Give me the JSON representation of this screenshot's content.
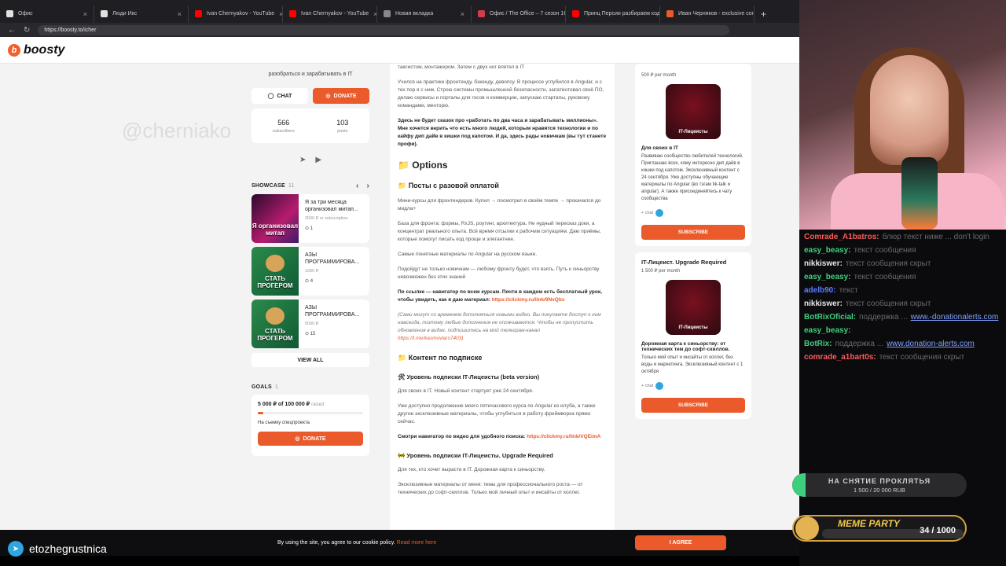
{
  "browser": {
    "tabs": [
      {
        "label": "Офис",
        "color": "#e0e0e0"
      },
      {
        "label": "Люди Икс",
        "color": "#e0e0e0"
      },
      {
        "label": "Ivan Chernyakov - YouTube",
        "color": "#ff0000"
      },
      {
        "label": "Ivan Chernyakov - YouTube",
        "color": "#ff0000"
      },
      {
        "label": "Новая вкладка",
        "color": "#888888"
      },
      {
        "label": "Офис / The Office – 7 сезон 16 се...",
        "color": "#d23b4a"
      },
      {
        "label": "Принц Персии разбираем код...",
        "color": "#ff0000"
      },
      {
        "label": "Иван Черняков - exclusive conte...",
        "color": "#ea5a2a"
      }
    ],
    "url": "https://boosty.to/icher"
  },
  "site": {
    "logo": "boosty"
  },
  "left": {
    "about": "разобраться и зарабатывать в IT",
    "chat_label": "CHAT",
    "donate_label": "DONATE",
    "subscribers_count": "566",
    "subscribers_label": "subscribers",
    "posts_count": "103",
    "posts_label": "posts",
    "showcase_title": "SHOWCASE",
    "showcase_count": "11",
    "showcase": [
      {
        "title": "Я за три месяца организовал митап...",
        "price": "3000 ₽ or subscription",
        "count": "1",
        "cap": "Я организовал митап"
      },
      {
        "title": "АЗЫ ПРОГРАММИРОВА...",
        "price": "1000 ₽",
        "count": "4",
        "cap": "СТАТЬ ПРОГЕРОМ"
      },
      {
        "title": "АЗЫ ПРОГРАММИРОВА...",
        "price": "5000 ₽",
        "count": "15",
        "cap": "СТАТЬ ПРОГЕРОМ"
      }
    ],
    "view_all": "VIEW ALL",
    "goals_title": "GOALS",
    "goals_count": "1",
    "goal_amount": "5 000 ₽ of 100 000 ₽",
    "goal_raised": "raised",
    "goal_progress": 0.05,
    "goal_name": "На съемку спецпроекта",
    "goal_donate": "DONATE"
  },
  "watermark": "@cherniako",
  "middle": {
    "p_top": "таксистом, монтажером. Затем с двух ног влетел в IT",
    "p1": "Учился на практике фронтенду, бэкенду, девопсу. В процессе углубился в Angular, и с тех пор я с ним. Строю системы промышленной безопасности, запатентовал своё ПО, делаю сервисы и порталы для госов и коммерции, запускаю стартапы, руковожу командами, менторю.",
    "p2": "Здесь не будет сказок про «работать по два часа и зарабатывать миллионы». Мне хочется верить что есть много людей, которым нравятся технологии и по кайфу дип дайв в кишки под капотом. И да, здесь рады новичкам (вы тут станете профи).",
    "options": "📁 Options",
    "posts_once": "📁 Посты с разовой оплатой",
    "p3": "Мини-курсы для фронтендеров. Купил → посмотрел в своём темпе → прокачался до мидла+",
    "p4": "База для фронта: формы, RxJS, роутинг, архитектура. Не нудный пересказ доки, а концентрат реального опыта. Всё время отсылки к рабочим ситуациям. Даю приёмы, которые помогут писать код проще и элегантнее.",
    "p5": "Самые понятные материалы по Angular на русском языке.",
    "p6": "Подойдут не только новичкам — любому фронту будет, что взять. Путь к синьорству невозможен без этих знаний",
    "p7_a": "По ссылке — навигатор по всем курсам. Почти в каждом есть бесплатный урок, чтобы увидеть, как я даю материал: ",
    "p7_link": "https://clickmy.ru/link/9NvQbs",
    "p8": "(Сами могут со временем дополняться новыми видео. Вы покупаете доступ к ним навсегда, поэтому любые дополнения не оплачиваются. Чтобы не пропустить обновления в видах, подпишитесь на мой телеграм-канал ",
    "p8_link": "https://t.me/kasmovlars7403)",
    "subs_content": "📁 Контент по подписке",
    "tier1_head": "🛠 Уровень подписки IT-Лицеисты (beta version)",
    "p9": "Для своих в IT. Новый контент стартует уже 24 сентября.",
    "p10": "Уже доступно продолжение моего пятичасового курса по Angular из ютуба, а также другие эксклюзивные материалы, чтобы углубиться в работу фреймворка прямо сейчас.",
    "p11_a": "Смотри навигатор по видео для удобного поиска: ",
    "p11_link": "https://clickmy.ru/link/VQEimA",
    "tier2_head": "🚧 Уровень подписки IT-Лицеисты. Upgrade Required",
    "p12": "Для тех, кто хочет вырасти в IT. Дорожная карта к синьорству.",
    "p13": "Эксклюзивные материалы от меня: темы для профессионального роста — от технических до софт-скиллов. Только мой личный опыт и инсайты от коллег."
  },
  "right": {
    "tier1_price": "500 ₽ per month",
    "tier1_img": "IT-Лицеисты",
    "tier1_sub": "Для своих в IT",
    "tier1_desc": "Развиваю сообщество любителей технологий. Приглашаю всех, кому интересно дип дайв в кишки под капотом. Эксклюзивный контент с 24 сентября. Уже доступны обучающие материалы по Angular (во тэгам tik-talk и angular). А также присоединяйтесь к чату сообщества",
    "tier1_chat": "+ chat",
    "tier1_subscribe": "SUBSCRIBE",
    "tier2_title": "IT-Лицеист. Upgrade Required",
    "tier2_price": "1 500 ₽ per month",
    "tier2_img": "IT-Лицеисты",
    "tier2_sub": "Дорожная карта к синьорству: от технических тем до софт-скиллов.",
    "tier2_desc": "Только мой опыт и инсайты от коллег, без воды и маркетинга. Эксклюзивный контент с 1 октября",
    "tier2_chat": "+ chat",
    "tier2_subscribe": "SUBSCRIBE"
  },
  "cookie": {
    "text": "By using the site, you agree to our cookie policy.",
    "read_more": "Read more here",
    "agree": "I AGREE"
  },
  "stream": {
    "name": "etozhegrustnica",
    "chat": [
      {
        "user": "Comrade_A1batros:",
        "color": "#ff5a5a",
        "text": "блюр текст ниже ... don't login",
        "link": ""
      },
      {
        "user": "easy_beasy:",
        "color": "#3ecf7e",
        "text": "текст сообщения",
        "link": ""
      },
      {
        "user": "nikkiswer:",
        "color": "#e8e8ea",
        "text": "текст сообщения скрыт",
        "link": ""
      },
      {
        "user": "easy_beasy:",
        "color": "#3ecf7e",
        "text": "текст сообщения",
        "link": ""
      },
      {
        "user": "adelb90:",
        "color": "#5a7cff",
        "text": "текст",
        "link": ""
      },
      {
        "user": "nikkiswer:",
        "color": "#e8e8ea",
        "text": "текст сообщения скрыт",
        "link": ""
      },
      {
        "user": "BotRixOficial:",
        "color": "#3ecf7e",
        "text": "поддержка ...",
        "link": "www.-donationalerts.com"
      },
      {
        "user": "easy_beasy:",
        "color": "#3ecf7e",
        "text": "",
        "link": ""
      },
      {
        "user": "BotRix:",
        "color": "#3ecf7e",
        "text": "поддержка ...",
        "link": "www.donation-alerts.com"
      },
      {
        "user": "comrade_a1bart0s:",
        "color": "#ff5a5a",
        "text": "текст сообщения скрыт",
        "link": ""
      }
    ],
    "donation_title": "НА СНЯТИЕ ПРОКЛЯТЬЯ",
    "donation_progress": "1 500 / 20 000 RUB",
    "donation_fraction": 0.075,
    "meme_title": "MEME PARTY",
    "meme_count": "34 / 1000"
  }
}
